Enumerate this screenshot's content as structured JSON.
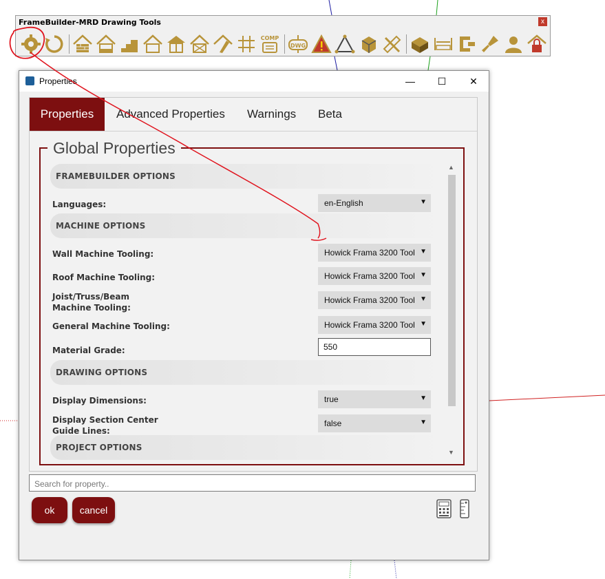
{
  "toolbar": {
    "title": "FrameBuilder-MRD Drawing Tools",
    "close_label": "x",
    "comp_label": "COMP",
    "dwg_label": "DWG",
    "icons": [
      "gear-icon",
      "refresh-icon",
      "house-wall-icon",
      "house-icon",
      "stairs-icon",
      "house-outline-icon",
      "house-frame-icon",
      "house-cross-icon",
      "pencil-house-icon",
      "grid-icon",
      "comp-icon",
      "dwg-icon",
      "warning-icon",
      "triangle-tool-icon",
      "cube-edit-icon",
      "ruler-pencil-icon",
      "box-icon",
      "measure-icon",
      "clamp-icon",
      "brush-icon",
      "user-icon",
      "lock-house-icon"
    ]
  },
  "dialog": {
    "title": "Properties",
    "minimize": "—",
    "maximize": "☐",
    "close": "✕"
  },
  "tabs": [
    "Properties",
    "Advanced Properties",
    "Warnings",
    "Beta"
  ],
  "active_tab": "Properties",
  "group_title": "Global Properties",
  "sections": {
    "framebuilder": "FRAMEBUILDER OPTIONS",
    "machine": "MACHINE OPTIONS",
    "drawing": "DRAWING OPTIONS",
    "project": "PROJECT OPTIONS"
  },
  "fields": {
    "languages": {
      "label": "Languages:",
      "value": "en-English"
    },
    "wall_tooling": {
      "label": "Wall Machine Tooling:",
      "value": "Howick Frama 3200 Tool"
    },
    "roof_tooling": {
      "label": "Roof Machine Tooling:",
      "value": "Howick Frama 3200 Tool"
    },
    "joist_tooling": {
      "label": "Joist/Truss/Beam Machine Tooling:",
      "value": "Howick Frama 3200 Tool"
    },
    "general_tooling": {
      "label": "General Machine Tooling:",
      "value": "Howick Frama 3200 Tool"
    },
    "material_grade": {
      "label": "Material Grade:",
      "value": "550"
    },
    "display_dimensions": {
      "label": "Display Dimensions:",
      "value": "true"
    },
    "section_guides": {
      "label": "Display Section Center Guide Lines:",
      "value": "false"
    }
  },
  "search": {
    "placeholder": "Search for property.."
  },
  "buttons": {
    "ok": "ok",
    "cancel": "cancel"
  },
  "colors": {
    "accent": "#7d0f10",
    "annotation": "#e0141e",
    "toolbar_gold": "#b8943a"
  }
}
